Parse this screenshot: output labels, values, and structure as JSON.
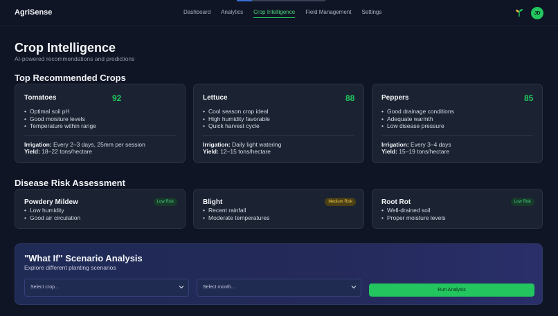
{
  "app": {
    "brand": "AgriSense",
    "avatar_initials": "JD",
    "accent_color": "#22c55e"
  },
  "nav": {
    "items": [
      {
        "label": "Dashboard",
        "active": false
      },
      {
        "label": "Analytics",
        "active": false
      },
      {
        "label": "Crop Intelligence",
        "active": true
      },
      {
        "label": "Field Management",
        "active": false
      },
      {
        "label": "Settings",
        "active": false
      }
    ]
  },
  "header": {
    "title": "Crop Intelligence",
    "subtitle": "AI-powered recommendations and predictions"
  },
  "recommended": {
    "title": "Top Recommended Crops",
    "irrigation_label": "Irrigation:",
    "yield_label": "Yield:",
    "crops": [
      {
        "name": "Tomatoes",
        "score": "92",
        "reasons": [
          "Optimal soil pH",
          "Good moisture levels",
          "Temperature within range"
        ],
        "irrigation": "Every 2–3 days, 25mm per session",
        "yield": "18–22 tons/hectare"
      },
      {
        "name": "Lettuce",
        "score": "88",
        "reasons": [
          "Cool season crop ideal",
          "High humidity favorable",
          "Quick harvest cycle"
        ],
        "irrigation": "Daily light watering",
        "yield": "12–15 tons/hectare"
      },
      {
        "name": "Peppers",
        "score": "85",
        "reasons": [
          "Good drainage conditions",
          "Adequate warmth",
          "Low disease pressure"
        ],
        "irrigation": "Every 3–4 days",
        "yield": "15–19 tons/hectare"
      }
    ]
  },
  "disease": {
    "title": "Disease Risk Assessment",
    "risks": [
      {
        "name": "Powdery Mildew",
        "level": "Low Risk",
        "kind": "low",
        "factors": [
          "Low humidity",
          "Good air circulation"
        ]
      },
      {
        "name": "Blight",
        "level": "Medium Risk",
        "kind": "medium",
        "factors": [
          "Recent rainfall",
          "Moderate temperatures"
        ]
      },
      {
        "name": "Root Rot",
        "level": "Low Risk",
        "kind": "low",
        "factors": [
          "Well-drained soil",
          "Proper moisture levels"
        ]
      }
    ]
  },
  "scenario": {
    "title": "\"What If\" Scenario Analysis",
    "subtitle": "Explore different planting scenarios",
    "crop_select": "Select crop...",
    "month_select": "Select month...",
    "run_label": "Run Analysis"
  },
  "icons": {
    "brand_action": "sprout-icon",
    "select_caret": "chevron-down-icon"
  }
}
